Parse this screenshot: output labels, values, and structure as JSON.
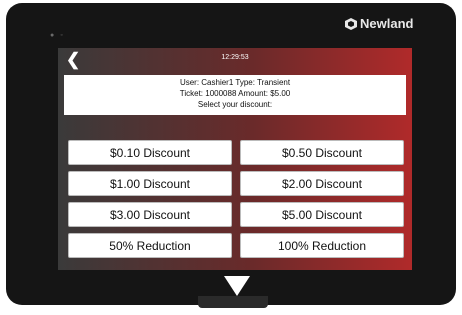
{
  "device": {
    "brand_name": "Newland",
    "sensor_icons": [
      "camera-icon",
      "sensor-icon"
    ]
  },
  "screen": {
    "time": "12:29:53",
    "info": {
      "line1": "User: Cashier1 Type: Transient",
      "line2": "Ticket: 1000088 Amount: $5.00",
      "line3": "Select your discount:"
    },
    "discount_buttons": [
      "$0.10 Discount",
      "$0.50 Discount",
      "$1.00 Discount",
      "$2.00 Discount",
      "$3.00 Discount",
      "$5.00 Discount",
      "50% Reduction",
      "100% Reduction"
    ]
  },
  "colors": {
    "bezel": "#151515",
    "screen_left": "#3a3a3a",
    "screen_right": "#b02a2a"
  }
}
